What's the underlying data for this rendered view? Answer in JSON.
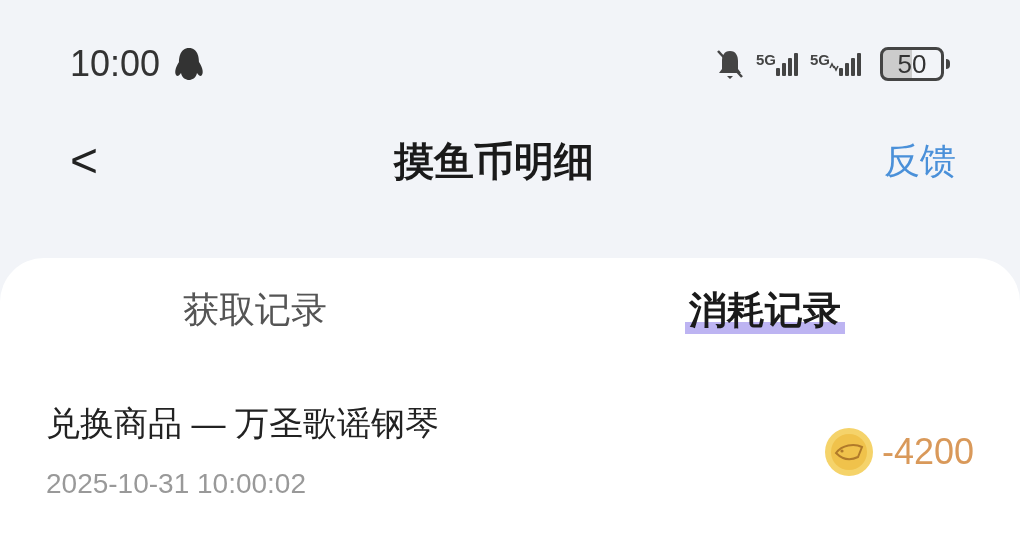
{
  "status_bar": {
    "time": "10:00",
    "networks": [
      "5G",
      "5G"
    ],
    "battery": "50"
  },
  "header": {
    "back": "<",
    "title": "摸鱼币明细",
    "action": "反馈"
  },
  "tabs": [
    {
      "label": "获取记录",
      "selected": false
    },
    {
      "label": "消耗记录",
      "selected": true
    }
  ],
  "records": [
    {
      "title": "兑换商品 — 万圣歌谣钢琴",
      "time": "2025-10-31 10:00:02",
      "amount": "-4200"
    }
  ]
}
